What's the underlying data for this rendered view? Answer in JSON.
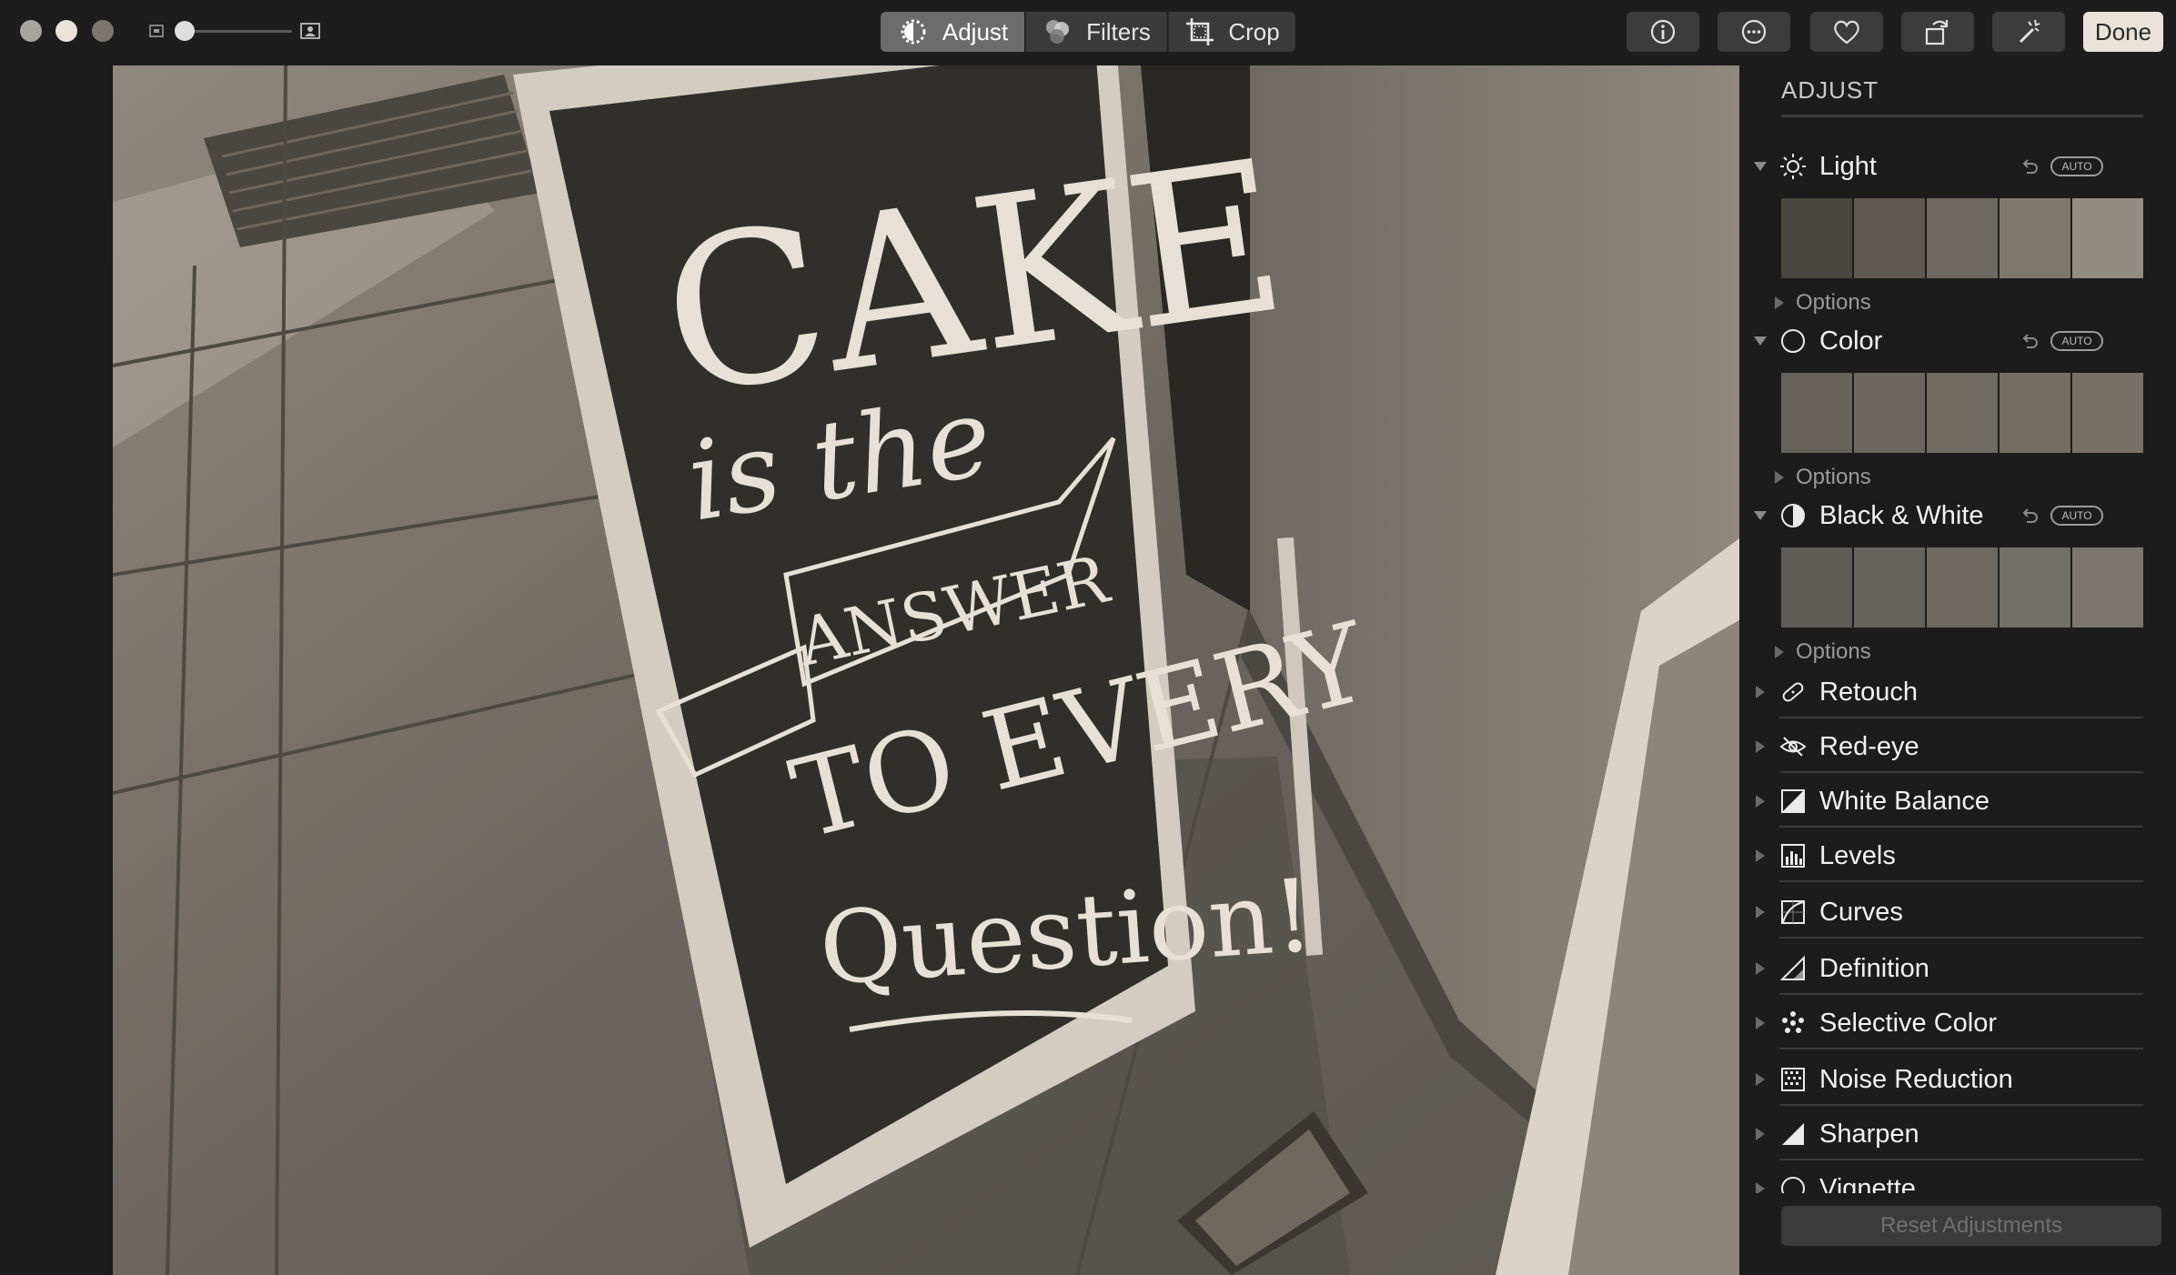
{
  "toolbar": {
    "tabs": [
      {
        "label": "Adjust",
        "icon": "adjust-dial-icon",
        "active": true
      },
      {
        "label": "Filters",
        "icon": "filters-circles-icon",
        "active": false
      },
      {
        "label": "Crop",
        "icon": "crop-icon",
        "active": false
      }
    ],
    "right_buttons": [
      "info-icon",
      "more-icon",
      "heart-icon",
      "rotate-icon",
      "magic-wand-icon"
    ],
    "done_label": "Done"
  },
  "photo": {
    "chalkboard_text": [
      "CAKE",
      "is the",
      "ANSWER",
      "TO EVERY",
      "Question!"
    ]
  },
  "sidebar": {
    "title": "ADJUST",
    "sections": [
      {
        "label": "Light",
        "icon": "sun-icon",
        "auto": "AUTO",
        "options_label": "Options"
      },
      {
        "label": "Color",
        "icon": "color-circle-icon",
        "auto": "AUTO",
        "options_label": "Options"
      },
      {
        "label": "Black & White",
        "icon": "half-circle-icon",
        "auto": "AUTO",
        "options_label": "Options"
      }
    ],
    "tools": [
      {
        "label": "Retouch",
        "icon": "bandage-icon"
      },
      {
        "label": "Red-eye",
        "icon": "red-eye-icon"
      },
      {
        "label": "White Balance",
        "icon": "white-balance-icon"
      },
      {
        "label": "Levels",
        "icon": "levels-icon"
      },
      {
        "label": "Curves",
        "icon": "curves-icon"
      },
      {
        "label": "Definition",
        "icon": "definition-icon"
      },
      {
        "label": "Selective Color",
        "icon": "selective-color-icon"
      },
      {
        "label": "Noise Reduction",
        "icon": "noise-reduction-icon"
      },
      {
        "label": "Sharpen",
        "icon": "sharpen-icon"
      },
      {
        "label": "Vignette",
        "icon": "vignette-icon"
      }
    ],
    "reset_label": "Reset Adjustments"
  }
}
